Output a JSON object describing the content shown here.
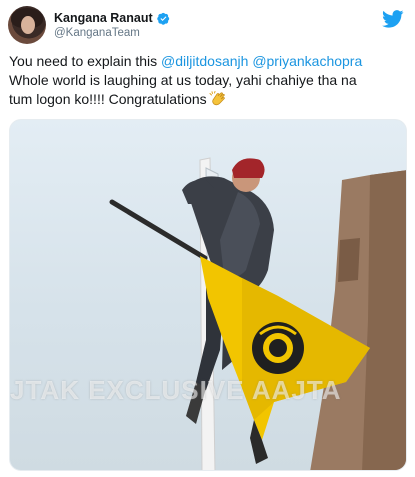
{
  "author": {
    "display_name": "Kangana Ranaut",
    "handle": "@KanganaTeam",
    "verified": true
  },
  "tweet": {
    "text_line1_prefix": "You need to explain this ",
    "mention1": "@diljitdosanjh",
    "mention_sep": " ",
    "mention2": "@priyankachopra",
    "text_line2": "Whole world is laughing at us today, yahi chahiye tha na",
    "text_line3": "tum logon ko!!!! Congratulations"
  },
  "media": {
    "watermark": "JTAK EXCLUSIVE AAJTA"
  },
  "colors": {
    "mention": "#1b95e0",
    "twitter_blue": "#1da1f2",
    "flag_yellow": "#f2c500"
  },
  "icons": [
    "verified-badge-icon",
    "twitter-bird-icon",
    "clapping-hands-emoji"
  ]
}
